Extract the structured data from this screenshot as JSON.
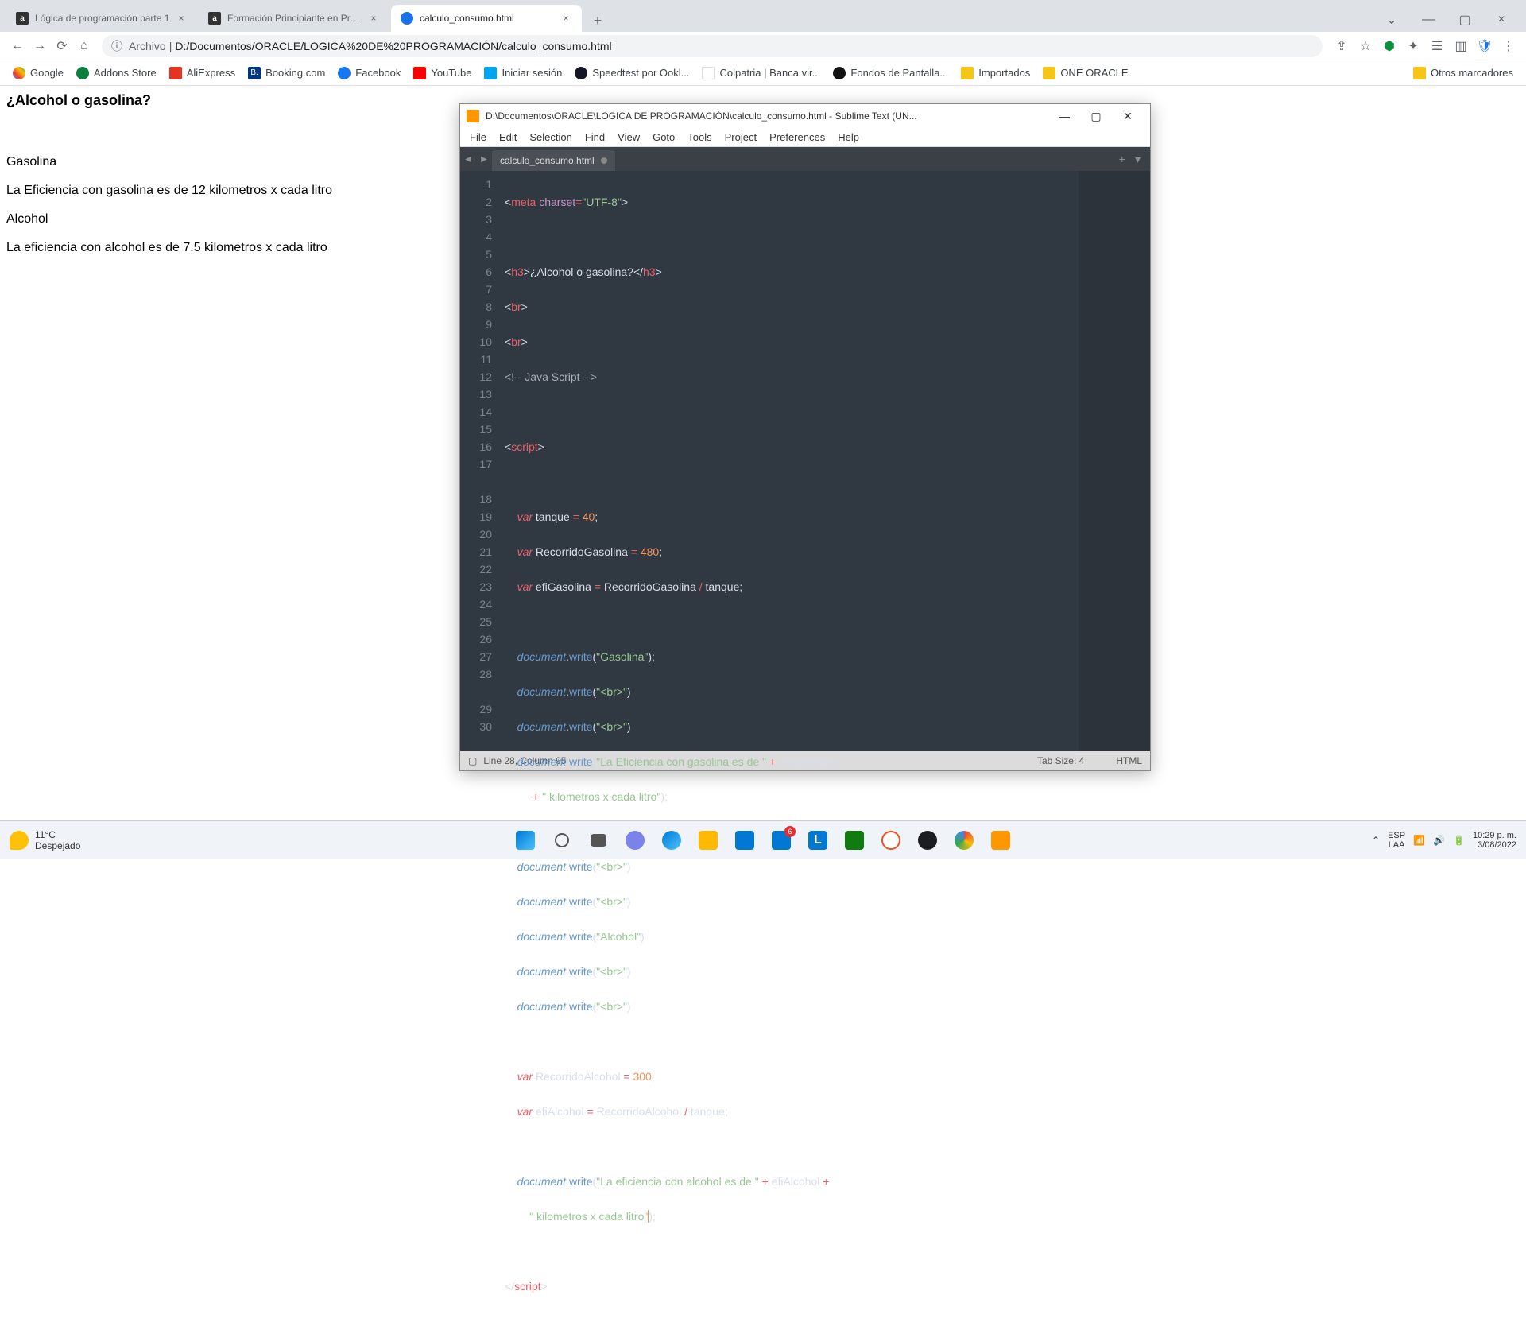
{
  "browser": {
    "tabs": [
      {
        "title": "Lógica de programación parte 1",
        "active": false
      },
      {
        "title": "Formación Principiante en Progra",
        "active": false
      },
      {
        "title": "calculo_consumo.html",
        "active": true
      }
    ],
    "address_prefix": "Archivo",
    "address_path": "D:/Documentos/ORACLE/LOGICA%20DE%20PROGRAMACIÓN/calculo_consumo.html",
    "bookmarks": [
      {
        "label": "Google",
        "color": "#fff"
      },
      {
        "label": "Addons Store",
        "color": "#0a7f3f"
      },
      {
        "label": "AliExpress",
        "color": "#e43225"
      },
      {
        "label": "Booking.com",
        "color": "#003580"
      },
      {
        "label": "Facebook",
        "color": "#1877f2"
      },
      {
        "label": "YouTube",
        "color": "#ff0000"
      },
      {
        "label": "Iniciar sesión",
        "color": "#00a4ef"
      },
      {
        "label": "Speedtest por Ookl...",
        "color": "#141526"
      },
      {
        "label": "Colpatria | Banca vir...",
        "color": "#d40000"
      },
      {
        "label": "Fondos de Pantalla...",
        "color": "#111"
      },
      {
        "label": "Importados",
        "color": "#f5c518"
      },
      {
        "label": "ONE ORACLE",
        "color": "#f5c518"
      }
    ],
    "bookmarks_overflow": "Otros marcadores"
  },
  "page": {
    "heading": "¿Alcohol o gasolina?",
    "line1": "Gasolina",
    "line2": "La Eficiencia con gasolina es de 12 kilometros x cada litro",
    "line3": "Alcohol",
    "line4": "La eficiencia con alcohol es de 7.5 kilometros x cada litro"
  },
  "sublime": {
    "title": "D:\\Documentos\\ORACLE\\LOGICA DE PROGRAMACIÓN\\calculo_consumo.html - Sublime Text (UN...",
    "menu": [
      "File",
      "Edit",
      "Selection",
      "Find",
      "View",
      "Goto",
      "Tools",
      "Project",
      "Preferences",
      "Help"
    ],
    "tab_name": "calculo_consumo.html",
    "status": "Line 28, Column 95",
    "tab_size": "Tab Size: 4",
    "syntax": "HTML",
    "line_numbers": [
      "1",
      "2",
      "3",
      "4",
      "5",
      "6",
      "7",
      "8",
      "9",
      "10",
      "11",
      "12",
      "13",
      "14",
      "15",
      "16",
      "17",
      "",
      "18",
      "19",
      "20",
      "21",
      "22",
      "23",
      "24",
      "25",
      "26",
      "27",
      "28",
      "",
      "29",
      "30"
    ]
  },
  "taskbar": {
    "temp": "11°C",
    "condition": "Despejado",
    "lang1": "ESP",
    "lang2": "LAA",
    "time": "10:29 p. m.",
    "date": "3/08/2022",
    "mail_badge": "6"
  }
}
